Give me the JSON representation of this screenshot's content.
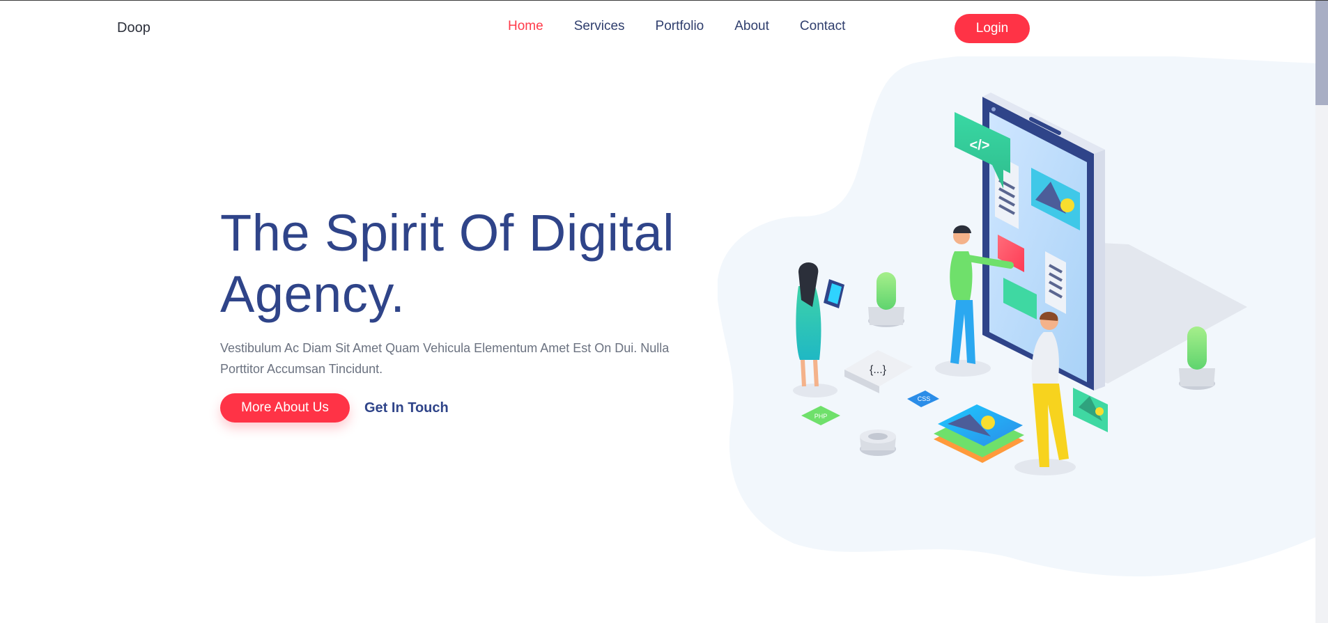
{
  "nav": {
    "brand": "Doop",
    "links": [
      {
        "label": "Home",
        "active": true
      },
      {
        "label": "Services"
      },
      {
        "label": "Portfolio"
      },
      {
        "label": "About"
      },
      {
        "label": "Contact"
      }
    ],
    "login_label": "Login"
  },
  "hero": {
    "title_line1": "The Spirit Of Digital",
    "title_line2": "Agency.",
    "description": "Vestibulum Ac Diam Sit Amet Quam Vehicula Elementum Amet Est On Dui. Nulla Porttitor Accumsan Tincidunt.",
    "primary_cta": "More About Us",
    "secondary_cta": "Get In Touch"
  },
  "illustration": {
    "code_bubble": "</>",
    "braces_tile": "{...}",
    "php_tag": "PHP",
    "css_tag": "CSS"
  },
  "colors": {
    "accent": "#ff3346",
    "heading": "#2f4489",
    "nav_text": "#2f3e6d",
    "body_text": "#6b7280",
    "blob": "#f2f7fc"
  }
}
